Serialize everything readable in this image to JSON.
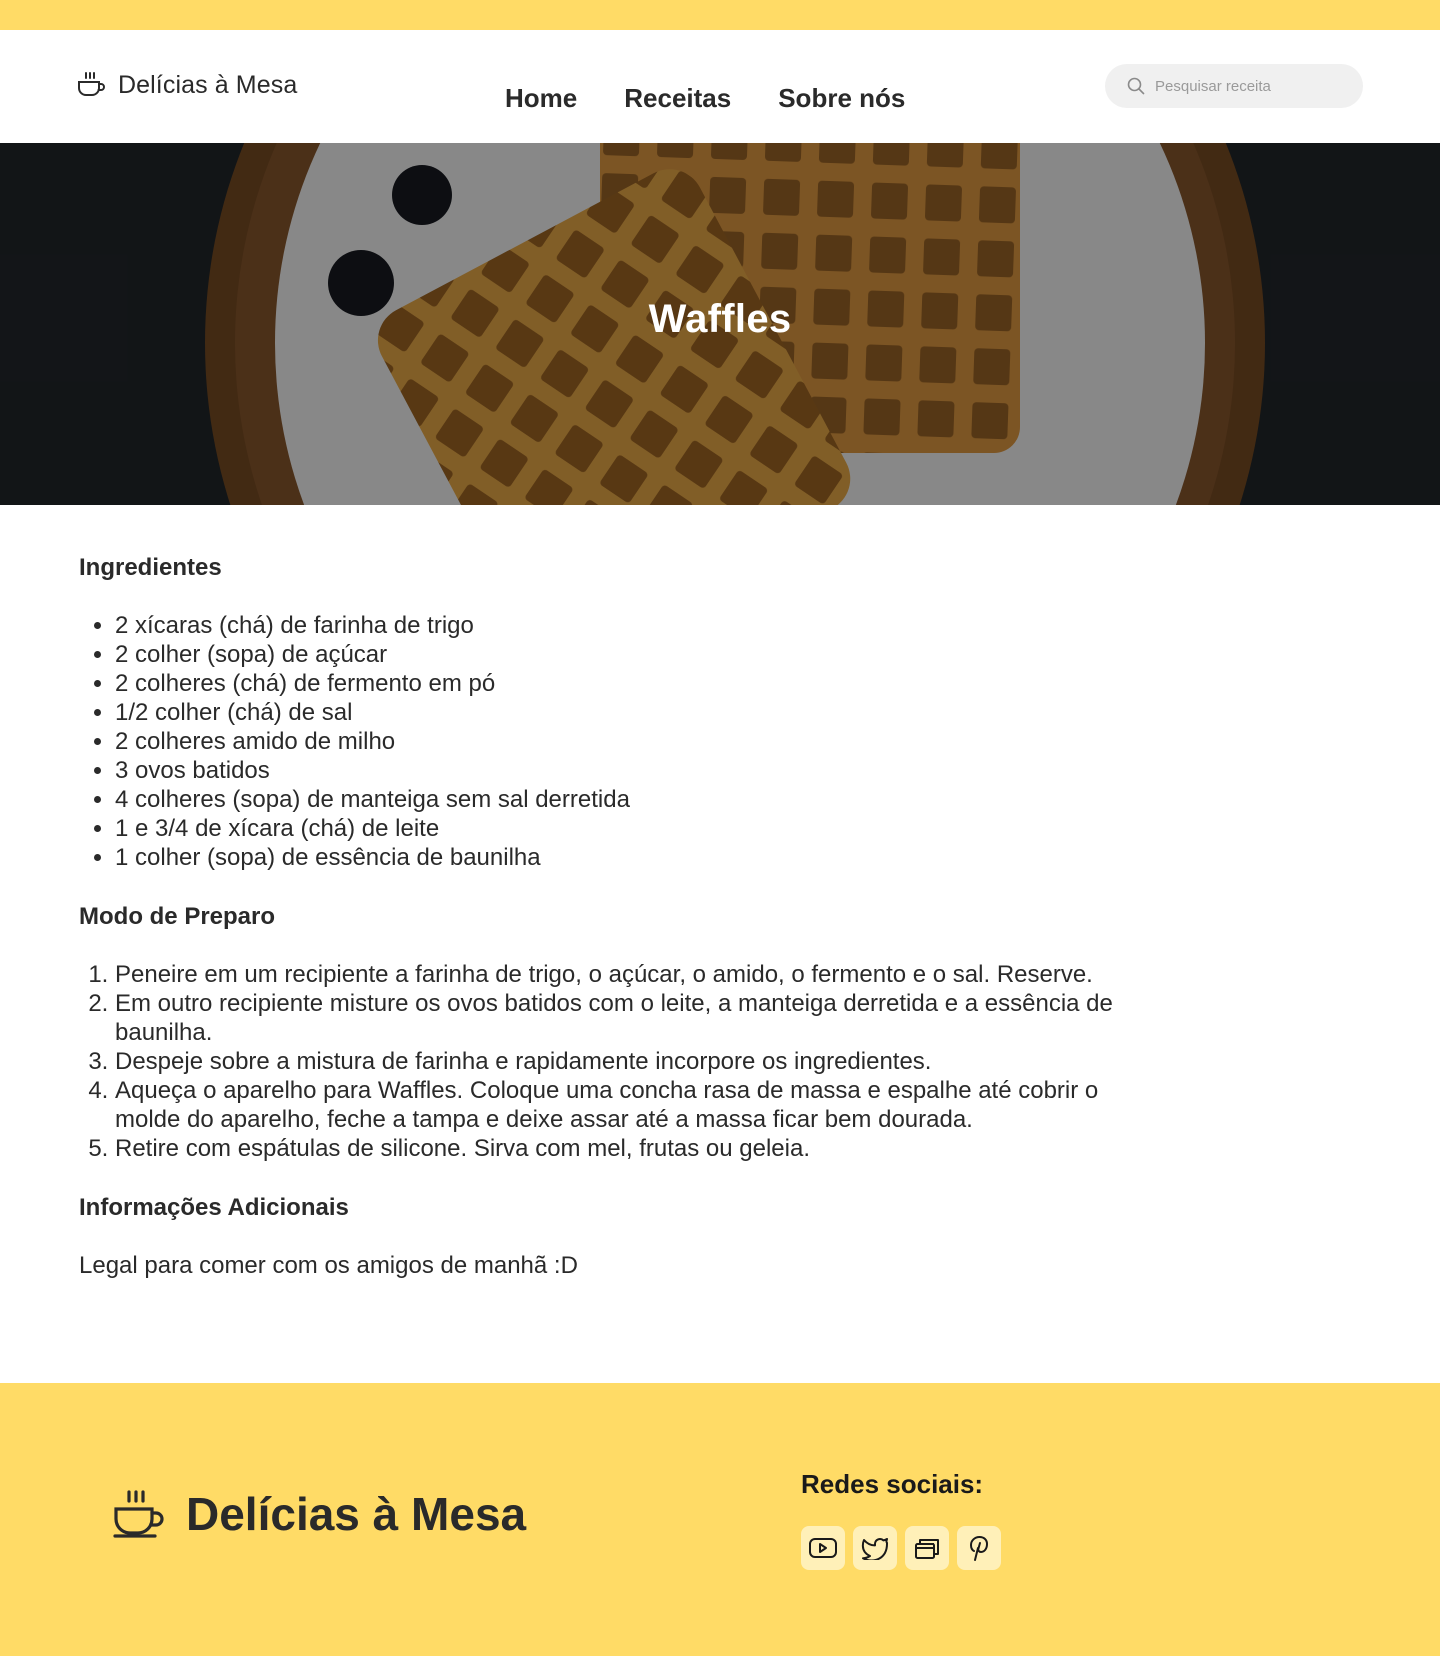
{
  "header": {
    "brand": "Delícias à Mesa",
    "nav": [
      "Home",
      "Receitas",
      "Sobre nós"
    ],
    "search_placeholder": "Pesquisar receita"
  },
  "hero": {
    "title": "Waffles"
  },
  "recipe": {
    "ingredients_title": "Ingredientes",
    "ingredients": [
      "2 xícaras (chá) de farinha de trigo",
      "2 colher (sopa) de açúcar",
      "2 colheres (chá) de fermento em pó",
      "1/2 colher (chá) de sal",
      "2 colheres amido de milho",
      "3 ovos batidos",
      "4 colheres (sopa) de manteiga sem sal derretida",
      "1 e 3/4 de xícara (chá) de leite",
      "1 colher (sopa) de essência de baunilha"
    ],
    "method_title": "Modo de Preparo",
    "steps": [
      "Peneire em um recipiente a farinha de trigo, o açúcar, o amido, o fermento e o sal. Reserve.",
      "Em outro recipiente misture os ovos batidos com o leite, a manteiga derretida e a essência de baunilha.",
      "Despeje sobre a mistura de farinha e rapidamente incorpore os ingredientes.",
      "Aqueça o aparelho para Waffles. Coloque uma concha rasa de massa e espalhe até cobrir o molde do aparelho, feche a tampa e deixe assar até a massa ficar bem dourada.",
      "Retire com espátulas de silicone. Sirva com mel, frutas ou geleia."
    ],
    "extra_title": "Informações Adicionais",
    "extra_text": "Legal para comer com os amigos de manhã :D"
  },
  "footer": {
    "brand": "Delícias à Mesa",
    "social_title": "Redes sociais:",
    "social_icons": [
      "youtube-icon",
      "twitter-icon",
      "gallery-icon",
      "pinterest-icon"
    ]
  },
  "colors": {
    "accent": "#ffdb66",
    "social_bg": "#fff0b8",
    "text": "#2a2a2a"
  }
}
